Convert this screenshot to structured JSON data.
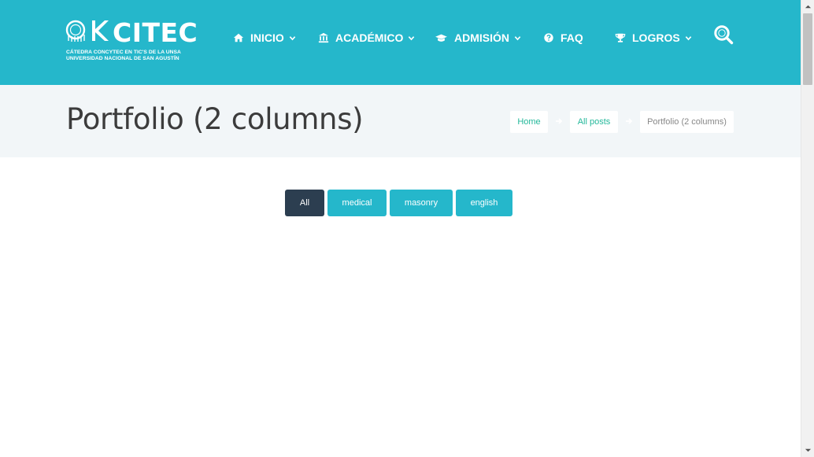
{
  "header": {
    "logo": {
      "word": "CITEC",
      "line1": "CÁTEDRA CONCYTEC EN TIC'S DE LA UNSA",
      "line2": "UNIVERSIDAD NACIONAL DE SAN AGUSTÍN"
    },
    "nav": [
      {
        "label": "INICIO",
        "icon": "home-icon",
        "has_dropdown": true
      },
      {
        "label": "ACADÉMICO",
        "icon": "institution-icon",
        "has_dropdown": true
      },
      {
        "label": "ADMISIÓN",
        "icon": "graduation-cap-icon",
        "has_dropdown": true
      },
      {
        "label": "FAQ",
        "icon": "question-circle-icon",
        "has_dropdown": false
      },
      {
        "label": "LOGROS",
        "icon": "trophy-icon",
        "has_dropdown": true
      }
    ],
    "search_icon": "search-icon"
  },
  "titlebar": {
    "title": "Portfolio (2 columns)",
    "breadcrumb": [
      {
        "label": "Home"
      },
      {
        "label": "All posts"
      },
      {
        "label": "Portfolio (2 columns)"
      }
    ]
  },
  "filters": [
    {
      "label": "All",
      "active": true
    },
    {
      "label": "medical",
      "active": false
    },
    {
      "label": "masonry",
      "active": false
    },
    {
      "label": "english",
      "active": false
    }
  ],
  "colors": {
    "header_bg": "#25b7cb",
    "active_filter": "#2c3e50",
    "breadcrumb_link": "#23b89a",
    "titlebar_bg": "#f2f6f8"
  }
}
